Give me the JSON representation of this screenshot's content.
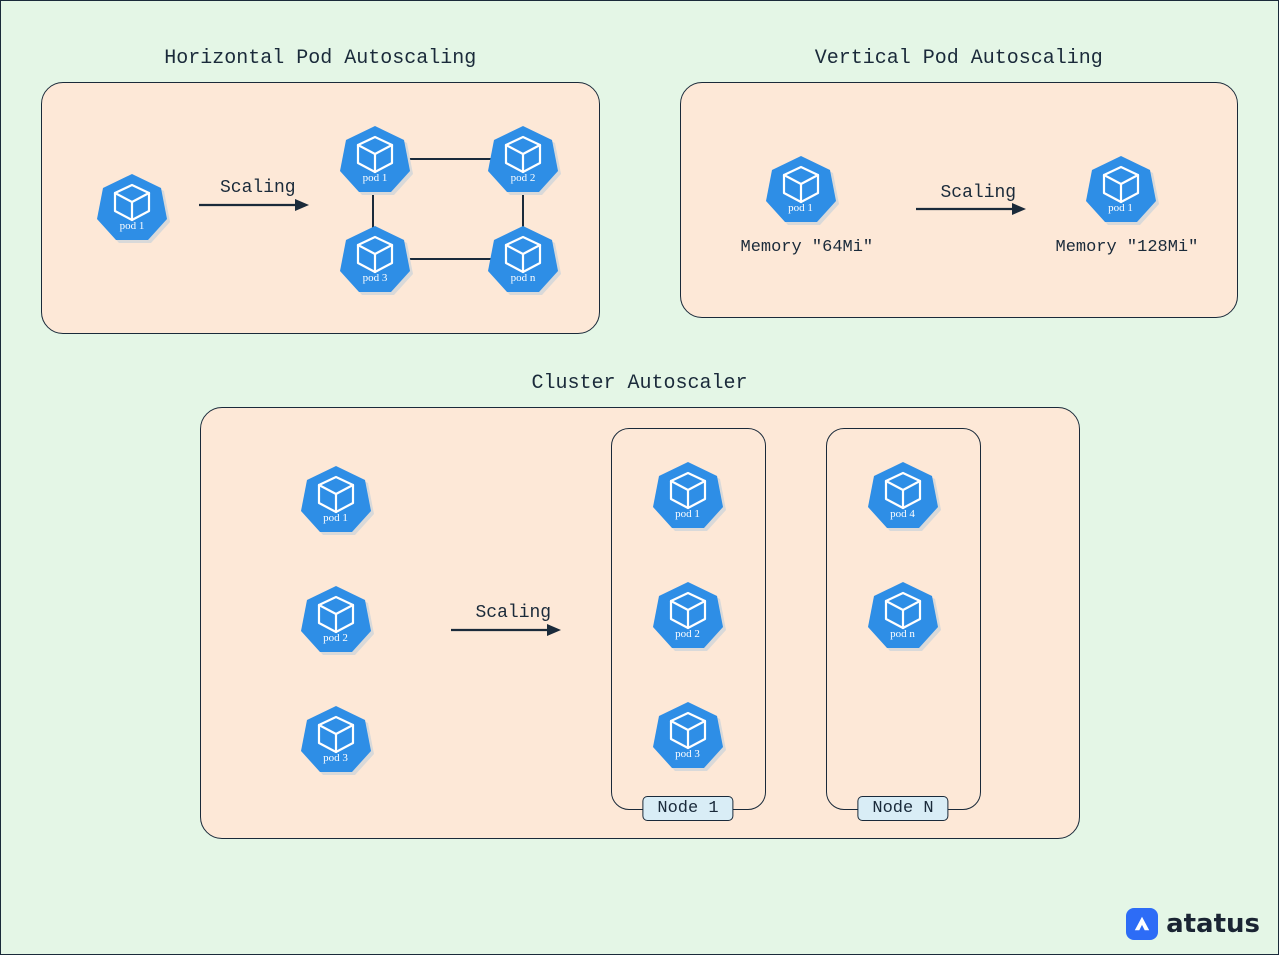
{
  "hpa": {
    "title": "Horizontal Pod Autoscaling",
    "scaling": "Scaling",
    "pods": {
      "src": "pod 1",
      "p1": "pod 1",
      "p2": "pod 2",
      "p3": "pod 3",
      "p4": "pod n"
    }
  },
  "vpa": {
    "title": "Vertical Pod Autoscaling",
    "scaling": "Scaling",
    "left": {
      "label": "pod 1",
      "mem": "Memory \"64Mi\""
    },
    "right": {
      "label": "pod 1",
      "mem": "Memory \"128Mi\""
    }
  },
  "ca": {
    "title": "Cluster Autoscaler",
    "scaling": "Scaling",
    "left_pods": {
      "p1": "pod 1",
      "p2": "pod 2",
      "p3": "pod 3"
    },
    "node1": {
      "label": "Node 1",
      "p1": "pod 1",
      "p2": "pod 2",
      "p3": "pod 3"
    },
    "nodeN": {
      "label": "Node N",
      "p1": "pod 4",
      "p2": "pod n"
    }
  },
  "brand": {
    "name": "atatus"
  }
}
